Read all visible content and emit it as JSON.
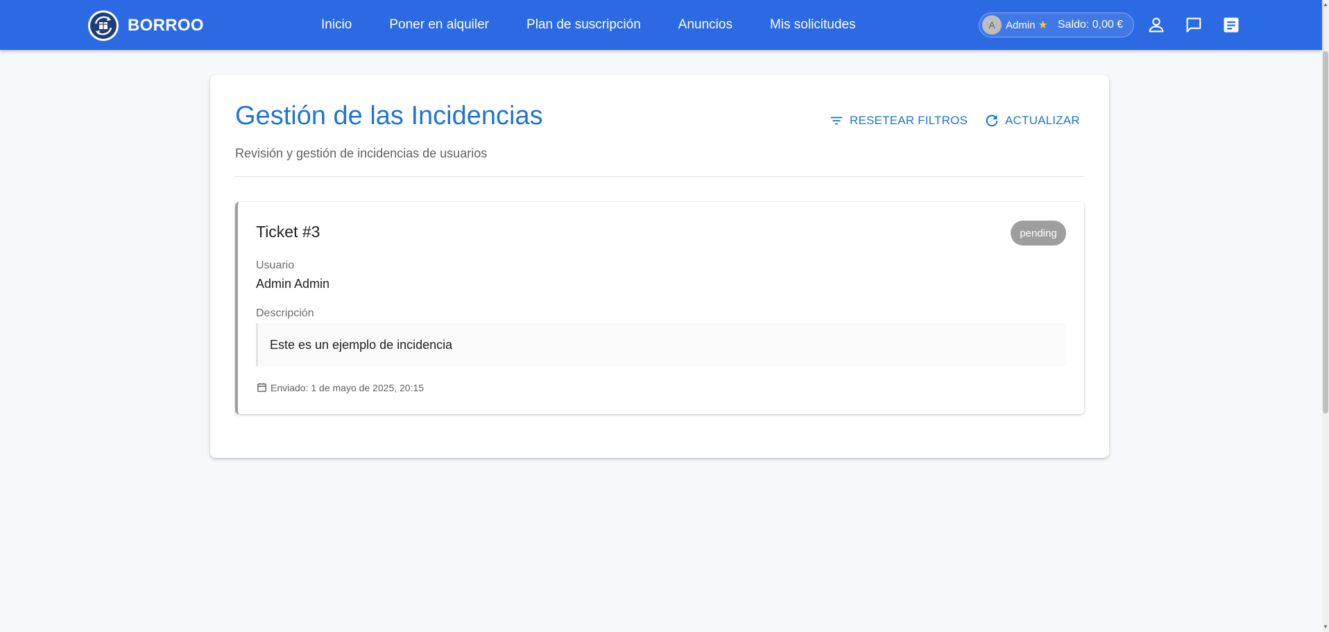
{
  "app": {
    "brand": "BORROO"
  },
  "nav": {
    "links": [
      "Inicio",
      "Poner en alquiler",
      "Plan de suscripción",
      "Anuncios",
      "Mis solicitudes"
    ],
    "user_chip": {
      "avatar_letter": "A",
      "name": "Admin",
      "star": "★",
      "balance": "Saldo: 0,00 €"
    },
    "icons": [
      "person-icon",
      "chat-icon",
      "notes-icon"
    ]
  },
  "page": {
    "title": "Gestión de las Incidencias",
    "subtitle": "Revisión y gestión de incidencias de usuarios",
    "reset_filters_label": "RESETEAR FILTROS",
    "refresh_label": "ACTUALIZAR"
  },
  "ticket": {
    "title": "Ticket #3",
    "status": "pending",
    "user_label": "Usuario",
    "user_value": "Admin Admin",
    "description_label": "Descripción",
    "description": "Este es un ejemplo de incidencia",
    "sent": "Enviado: 1 de mayo de 2025, 20:15"
  },
  "colors": {
    "navbar": "#2b6ae3",
    "accent": "#1976d2",
    "status_pending": "#9e9e9e",
    "background": "#f6f8fb"
  }
}
